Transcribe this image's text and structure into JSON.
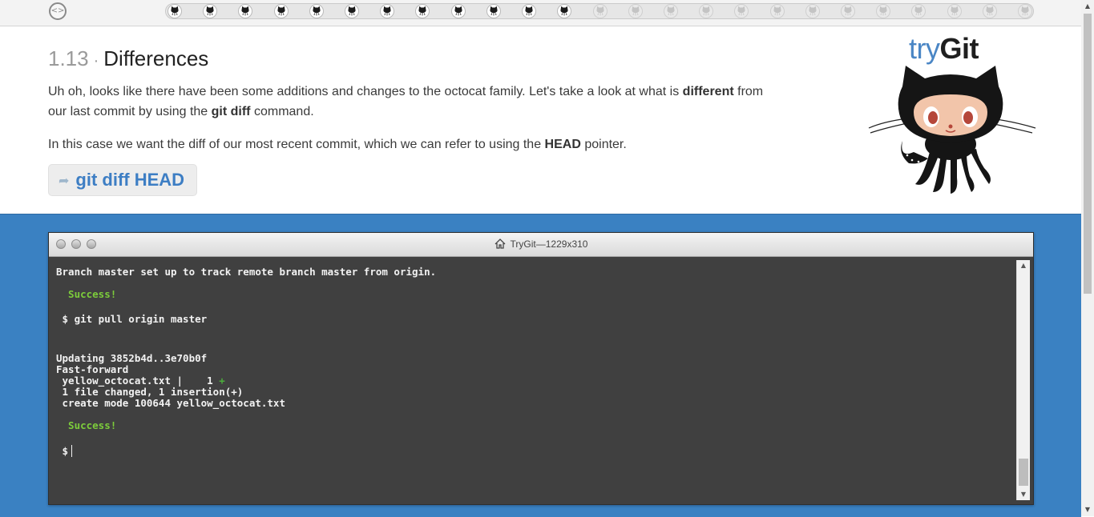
{
  "progress": {
    "toggle_icon": "code-brackets-icon",
    "lessons_total": 25,
    "lessons_completed": 12
  },
  "lesson": {
    "number": "1.13",
    "separator": "·",
    "title": "Differences",
    "para1": {
      "t1": "Uh oh, looks like there have been some additions and changes to the octocat family. Let's take a look at what is ",
      "b1": "different",
      "t2": " from our last commit by using the ",
      "b2": "git diff",
      "t3": " command."
    },
    "para2": {
      "t1": "In this case we want the diff of our most recent commit, which we can refer to using the ",
      "b1": "HEAD",
      "t2": " pointer."
    },
    "command": "git diff HEAD"
  },
  "logo": {
    "try": "try",
    "git": "Git"
  },
  "terminal": {
    "title": "TryGit—1229x310",
    "lines": {
      "l1": "Branch master set up to track remote branch master from origin.",
      "l2": "  Success!",
      "l3": " $ git pull origin master",
      "l4": "Updating 3852b4d..3e70b0f",
      "l5": "Fast-forward",
      "l6a": " yellow_octocat.txt |    1 ",
      "l6b": "+",
      "l7": " 1 file changed, 1 insertion(+)",
      "l8": " create mode 100644 yellow_octocat.txt",
      "l9": "  Success!",
      "l10": " $"
    }
  },
  "colors": {
    "accent_blue": "#3a81c2",
    "command_blue": "#3d7ec4",
    "success_green": "#7ccc3b"
  }
}
